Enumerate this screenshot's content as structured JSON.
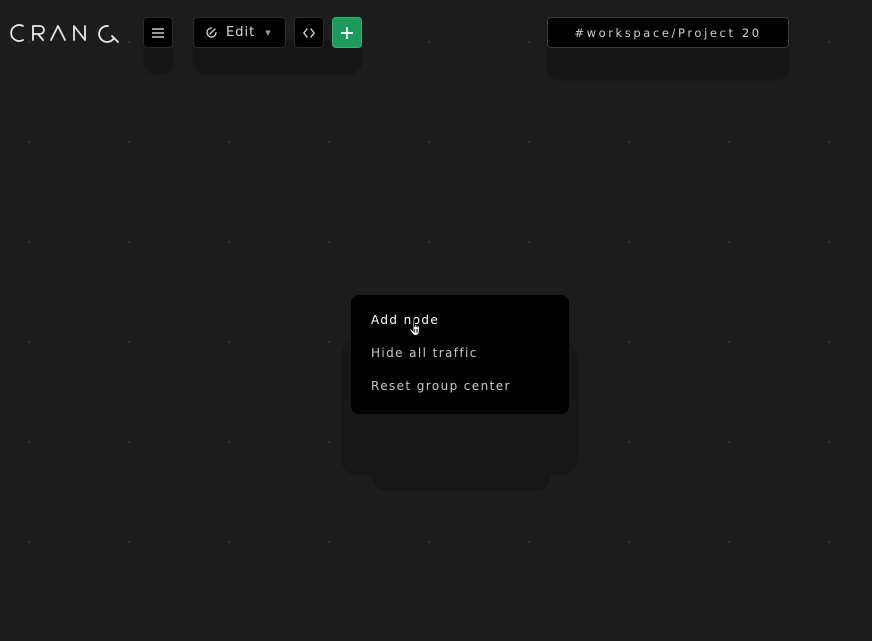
{
  "app": {
    "logo_text": "CRANQ"
  },
  "toolbar": {
    "menu_icon": "hamburger-menu-icon",
    "edit_label": "Edit",
    "edit_icon": "edit-mode-icon",
    "code_icon": "code-icon",
    "add_icon": "plus-icon",
    "workspace_path": "#workspace/Project 20"
  },
  "context_menu": {
    "items": [
      {
        "label": "Add node"
      },
      {
        "label": "Hide all traffic"
      },
      {
        "label": "Reset group center"
      }
    ],
    "hovered_index": 0
  },
  "colors": {
    "background": "#1d1d1d",
    "accent": "#1e9a5e",
    "menu_bg": "#000000"
  }
}
